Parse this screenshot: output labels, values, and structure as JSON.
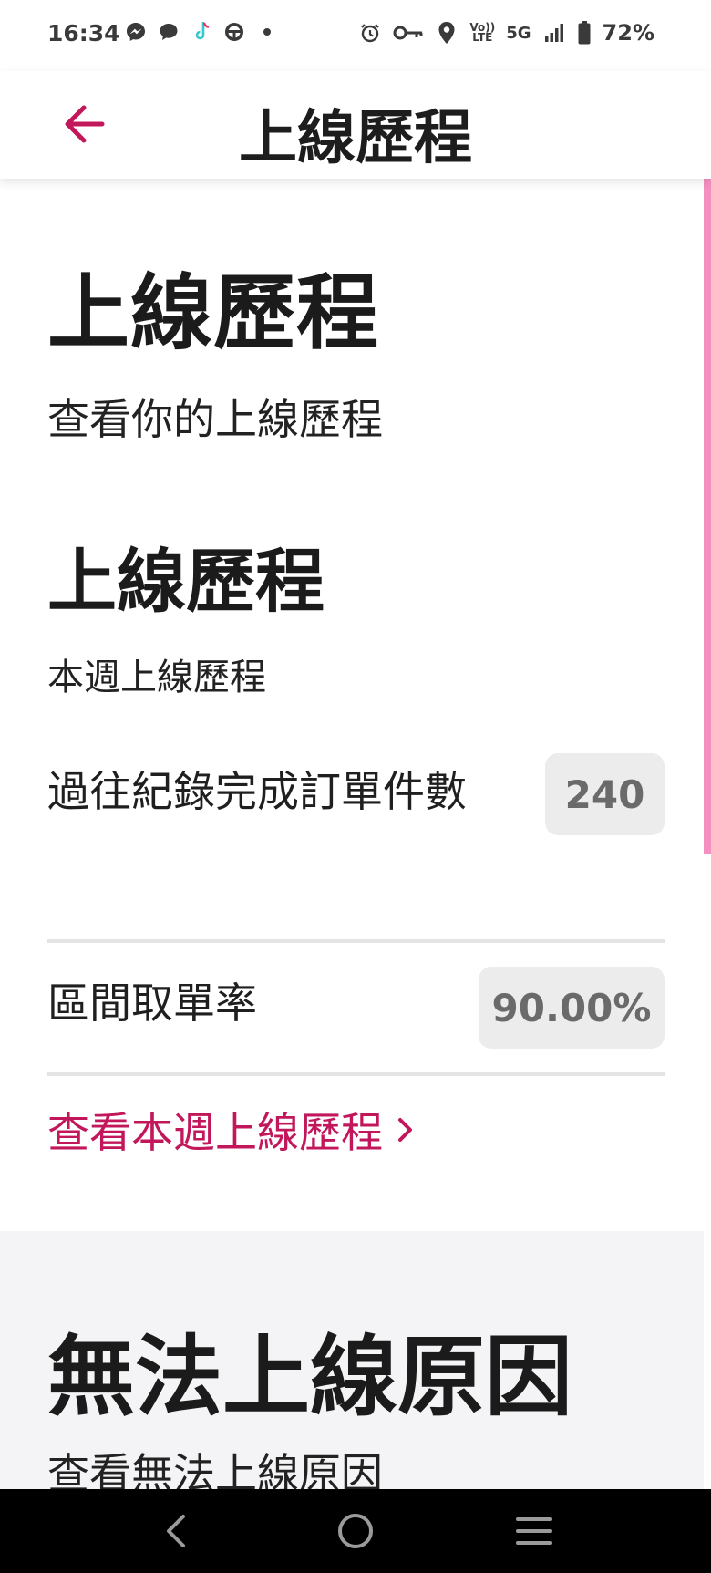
{
  "status_bar": {
    "time": "16:34",
    "battery": "72%",
    "network": "5G",
    "volte_top": "Vo))",
    "volte_bottom": "LTE",
    "left_icons": [
      "messenger-icon",
      "chat-icon",
      "tiktok-icon",
      "steering-wheel-icon",
      "dot-icon"
    ],
    "right_icons": [
      "alarm-icon",
      "key-icon",
      "location-icon",
      "volte-icon",
      "signal-icon",
      "battery-icon"
    ]
  },
  "header": {
    "title": "上線歷程",
    "back_icon": "arrow-left-icon"
  },
  "main": {
    "title": "上線歷程",
    "subtitle": "查看你的上線歷程",
    "section": {
      "title": "上線歷程",
      "subtitle": "本週上線歷程",
      "rows": [
        {
          "label": "過往紀錄完成訂單件數",
          "value": "240"
        },
        {
          "label": "區間取單率",
          "value": "90.00%"
        }
      ],
      "link_label": "查看本週上線歷程",
      "link_icon": "chevron-right-icon"
    },
    "second_section": {
      "title": "無法上線原因",
      "subtitle": "查看無法上線原因"
    }
  },
  "navbar": {
    "back_icon": "nav-back-icon",
    "home_icon": "nav-home-icon",
    "recents_icon": "nav-recents-icon"
  },
  "colors": {
    "accent": "#c2185b",
    "scroll_indicator": "#f48fc0",
    "pill_bg": "#ececec",
    "grey_section": "#f4f4f6"
  }
}
